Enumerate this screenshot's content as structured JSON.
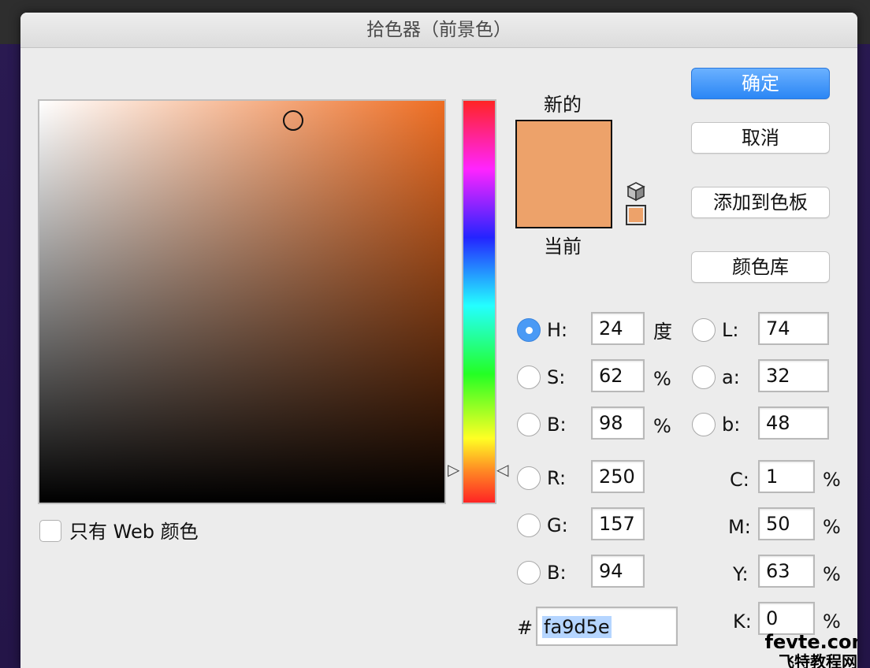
{
  "window": {
    "title": "拾色器（前景色）"
  },
  "buttons": {
    "ok": "确定",
    "cancel": "取消",
    "add_to_swatches": "添加到色板",
    "color_libraries": "颜色库"
  },
  "swatch": {
    "new_label": "新的",
    "current_label": "当前",
    "new_color": "#eda26a",
    "current_color": "#eda26a"
  },
  "web_only": {
    "label": "只有 Web 颜色",
    "checked": false
  },
  "hsb": [
    {
      "label": "H:",
      "value": "24",
      "unit": "度",
      "selected": true
    },
    {
      "label": "S:",
      "value": "62",
      "unit": "%",
      "selected": false
    },
    {
      "label": "B:",
      "value": "98",
      "unit": "%",
      "selected": false
    }
  ],
  "rgb": [
    {
      "label": "R:",
      "value": "250",
      "selected": false
    },
    {
      "label": "G:",
      "value": "157",
      "selected": false
    },
    {
      "label": "B:",
      "value": "94",
      "selected": false
    }
  ],
  "lab": [
    {
      "label": "L:",
      "value": "74",
      "selected": false
    },
    {
      "label": "a:",
      "value": "32",
      "selected": false
    },
    {
      "label": "b:",
      "value": "48",
      "selected": false
    }
  ],
  "cmyk": [
    {
      "label": "C:",
      "value": "1",
      "unit": "%"
    },
    {
      "label": "M:",
      "value": "50",
      "unit": "%"
    },
    {
      "label": "Y:",
      "value": "63",
      "unit": "%"
    },
    {
      "label": "K:",
      "value": "0",
      "unit": "%"
    }
  ],
  "hex": {
    "label": "#",
    "value": "fa9d5e"
  },
  "watermark": {
    "line1": "fevte.com",
    "line2": "飞特教程网"
  }
}
